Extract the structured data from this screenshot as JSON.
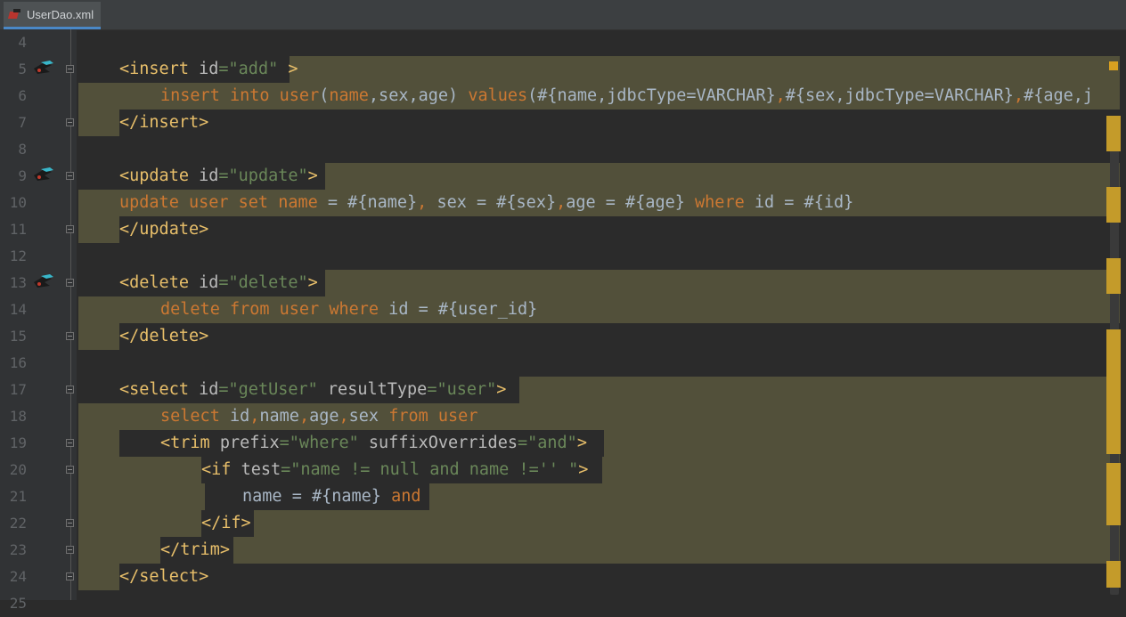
{
  "tab": {
    "title": "UserDao.xml",
    "icon": "xml-file-icon",
    "close": "×"
  },
  "watermark": "",
  "lines": [
    {
      "num": "4"
    },
    {
      "num": "5",
      "segments": [
        {
          "t": "<insert ",
          "c": "tag"
        },
        {
          "t": "id",
          "c": "attr"
        },
        {
          "t": "=\"add\"",
          "c": "str"
        },
        {
          "t": " >",
          "c": "tag"
        }
      ]
    },
    {
      "num": "6",
      "segments": [
        {
          "t": "insert into user",
          "c": "kw"
        },
        {
          "t": "(",
          "c": "plain"
        },
        {
          "t": "name",
          "c": "kw"
        },
        {
          "t": ",sex,age) ",
          "c": "plain"
        },
        {
          "t": "values",
          "c": "kw"
        },
        {
          "t": "(#{name,jdbcType=VARCHAR}",
          "c": "plain"
        },
        {
          "t": ",",
          "c": "kw"
        },
        {
          "t": "#{sex,jdbcType=VARCHAR}",
          "c": "plain"
        },
        {
          "t": ",",
          "c": "kw"
        },
        {
          "t": "#{age,j",
          "c": "plain"
        }
      ]
    },
    {
      "num": "7",
      "segments": [
        {
          "t": "</insert>",
          "c": "tag"
        }
      ]
    },
    {
      "num": "8"
    },
    {
      "num": "9",
      "segments": [
        {
          "t": "<update ",
          "c": "tag"
        },
        {
          "t": "id",
          "c": "attr"
        },
        {
          "t": "=\"update\"",
          "c": "str"
        },
        {
          "t": ">",
          "c": "tag"
        }
      ]
    },
    {
      "num": "10",
      "segments": [
        {
          "t": "update user set name",
          "c": "kw"
        },
        {
          "t": " = #{name}",
          "c": "plain"
        },
        {
          "t": ", ",
          "c": "kw"
        },
        {
          "t": "sex = #{sex}",
          "c": "plain"
        },
        {
          "t": ",",
          "c": "kw"
        },
        {
          "t": "age = #{age} ",
          "c": "plain"
        },
        {
          "t": "where",
          "c": "kw"
        },
        {
          "t": " id = #{id}",
          "c": "plain"
        }
      ]
    },
    {
      "num": "11",
      "segments": [
        {
          "t": "</update>",
          "c": "tag"
        }
      ]
    },
    {
      "num": "12"
    },
    {
      "num": "13",
      "segments": [
        {
          "t": "<delete ",
          "c": "tag"
        },
        {
          "t": "id",
          "c": "attr"
        },
        {
          "t": "=\"delete\"",
          "c": "str"
        },
        {
          "t": ">",
          "c": "tag"
        }
      ]
    },
    {
      "num": "14",
      "segments": [
        {
          "t": "delete from user where",
          "c": "kw"
        },
        {
          "t": " id = #{user_id}",
          "c": "plain"
        }
      ]
    },
    {
      "num": "15",
      "segments": [
        {
          "t": "</delete>",
          "c": "tag"
        }
      ]
    },
    {
      "num": "16"
    },
    {
      "num": "17",
      "segments": [
        {
          "t": "<select ",
          "c": "tag"
        },
        {
          "t": "id",
          "c": "attr"
        },
        {
          "t": "=\"getUser\" ",
          "c": "str"
        },
        {
          "t": "resultType",
          "c": "attr"
        },
        {
          "t": "=\"user\"",
          "c": "str"
        },
        {
          "t": ">",
          "c": "tag"
        }
      ]
    },
    {
      "num": "18",
      "segments": [
        {
          "t": "select ",
          "c": "kw"
        },
        {
          "t": "id",
          "c": "plain"
        },
        {
          "t": ",",
          "c": "kw"
        },
        {
          "t": "name",
          "c": "plain"
        },
        {
          "t": ",",
          "c": "kw"
        },
        {
          "t": "age",
          "c": "plain"
        },
        {
          "t": ",",
          "c": "kw"
        },
        {
          "t": "sex ",
          "c": "plain"
        },
        {
          "t": "from user",
          "c": "kw"
        }
      ]
    },
    {
      "num": "19",
      "segments": [
        {
          "t": "<trim ",
          "c": "tag"
        },
        {
          "t": "prefix",
          "c": "attr"
        },
        {
          "t": "=\"where\" ",
          "c": "str"
        },
        {
          "t": "suffixOverrides",
          "c": "attr"
        },
        {
          "t": "=\"and\"",
          "c": "str"
        },
        {
          "t": ">",
          "c": "tag"
        }
      ]
    },
    {
      "num": "20",
      "segments": [
        {
          "t": "<if ",
          "c": "tag"
        },
        {
          "t": "test",
          "c": "attr"
        },
        {
          "t": "=\"name != null and name !='' \"",
          "c": "str"
        },
        {
          "t": ">",
          "c": "tag"
        }
      ]
    },
    {
      "num": "21",
      "segments": [
        {
          "t": "name = #{name} ",
          "c": "plain"
        },
        {
          "t": "and",
          "c": "kw"
        }
      ]
    },
    {
      "num": "22",
      "segments": [
        {
          "t": "</if>",
          "c": "tag"
        }
      ]
    },
    {
      "num": "23",
      "segments": [
        {
          "t": "</trim>",
          "c": "tag"
        }
      ]
    },
    {
      "num": "24",
      "segments": [
        {
          "t": "</select>",
          "c": "tag"
        }
      ]
    },
    {
      "num": "25"
    }
  ],
  "colors": {
    "tag": "#e8bf6a",
    "keyword": "#cc7832",
    "string": "#6a8759",
    "attr": "#bababa",
    "plain": "#a9b7c6",
    "highlight": "#52503a"
  }
}
